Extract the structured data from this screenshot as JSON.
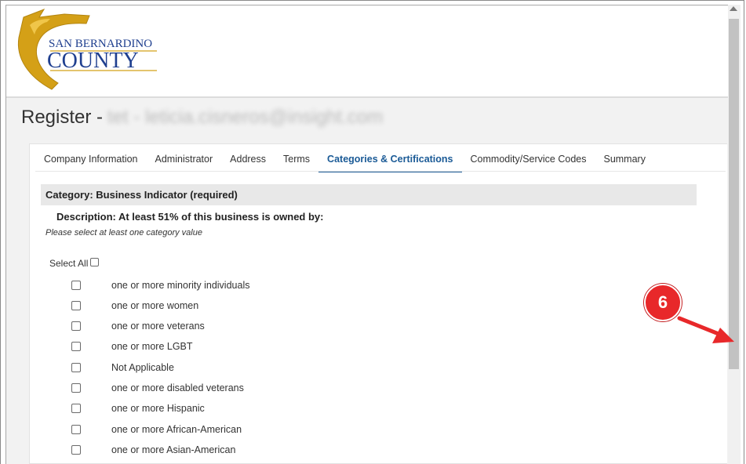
{
  "header": {
    "logo": {
      "line1": "SAN BERNARDINO",
      "line2": "COUNTY",
      "colors": {
        "gold": "#d4a017",
        "text": "#1f3f8f"
      }
    }
  },
  "page": {
    "title_prefix": "Register -",
    "title_redacted": "tet - leticia.cisneros@insight.com"
  },
  "tabs": [
    {
      "label": "Company Information",
      "active": false
    },
    {
      "label": "Administrator",
      "active": false
    },
    {
      "label": "Address",
      "active": false
    },
    {
      "label": "Terms",
      "active": false
    },
    {
      "label": "Categories & Certifications",
      "active": true
    },
    {
      "label": "Commodity/Service Codes",
      "active": false
    },
    {
      "label": "Summary",
      "active": false
    }
  ],
  "category": {
    "title": "Category: Business Indicator (required)",
    "description": "Description: At least 51% of this business is owned by:",
    "hint": "Please select at least one category value",
    "select_all_label": "Select All",
    "options": [
      "one or more minority individuals",
      "one or more women",
      "one or more veterans",
      "one or more LGBT",
      "Not Applicable",
      "one or more disabled veterans",
      "one or more Hispanic",
      "one or more African-American",
      "one or more Asian-American"
    ]
  },
  "annotation": {
    "step_number": "6",
    "color": "#e8282a"
  },
  "colors": {
    "accent": "#1a5a96",
    "category_bar": "#e8e8e8"
  }
}
